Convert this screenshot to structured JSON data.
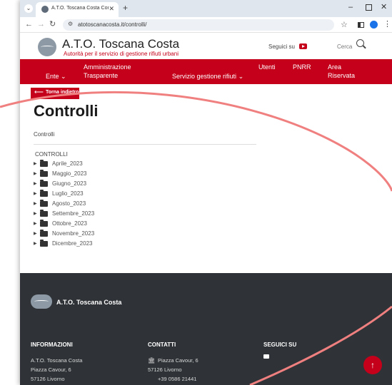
{
  "browser": {
    "tab_title": "A.T.O. Toscana Costa Controlli |",
    "url": "atotoscanacosta.it/controlli/",
    "icons": [
      "tab-search-icon",
      "favicon",
      "close-icon",
      "plus-icon",
      "minimize-icon",
      "maximize-icon",
      "close-icon",
      "back-icon",
      "forward-icon",
      "reload-icon",
      "site-info-icon",
      "star-icon",
      "side-panel-icon",
      "profile-icon",
      "kebab-menu-icon"
    ]
  },
  "header": {
    "site_name": "A.T.O. Toscana Costa",
    "tagline": "Autorità per il servizio di gestione rifiuti urbani",
    "follow_label": "Seguici su",
    "search_label": "Cerca"
  },
  "nav": {
    "ente": "Ente",
    "amministrazione_1": "Amministrazione",
    "amministrazione_2": "Trasparente",
    "servizio": "Servizio gestione rifiuti",
    "utenti": "Utenti",
    "pnrr": "PNRR",
    "area_1": "Area",
    "area_2": "Riservata",
    "chevron": "⌄"
  },
  "page": {
    "back_label": "Torna indietro",
    "title": "Controlli",
    "breadcrumb": "Controlli",
    "folder_heading": "CONTROLLI",
    "folders": [
      "Aprile_2023",
      "Maggio_2023",
      "Giugno_2023",
      "Luglio_2023",
      "Agosto_2023",
      "Settembre_2023",
      "Ottobre_2023",
      "Novembre_2023",
      "Dicembre_2023"
    ]
  },
  "footer": {
    "brand": "A.T.O. Toscana Costa",
    "info_heading": "INFORMAZIONI",
    "info_lines": [
      "A.T.O. Toscana Costa",
      "Piazza Cavour, 6",
      "57126 Livorno"
    ],
    "contacts_heading": "CONTATTI",
    "contacts_lines": [
      "Piazza Cavour, 6",
      "57126 Livorno",
      "+39 0586 21441"
    ],
    "social_heading": "SEGUICI SU"
  },
  "colors": {
    "brand_red": "#c4001a",
    "footer_bg": "#2f3337",
    "annotation": "#f08080"
  }
}
